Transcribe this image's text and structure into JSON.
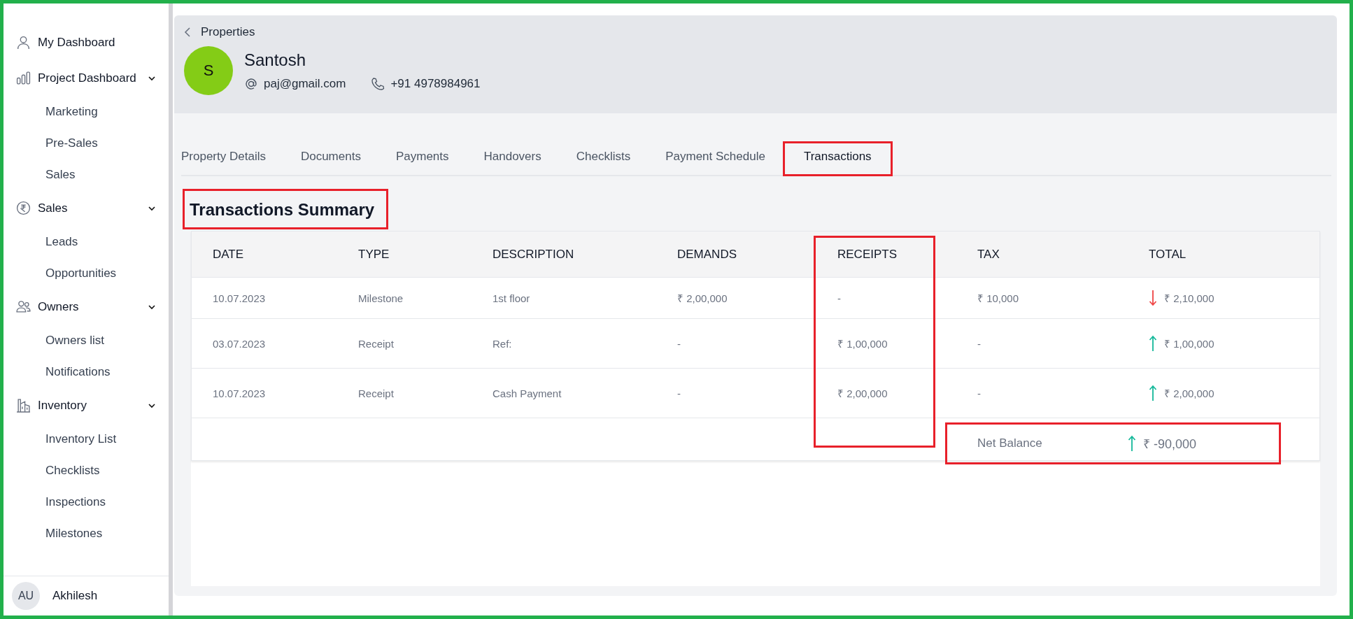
{
  "sidebar": {
    "items": [
      {
        "kind": "link",
        "label": "My Dashboard"
      },
      {
        "kind": "group",
        "label": "Project Dashboard",
        "expanded": true,
        "children": [
          {
            "label": "Marketing"
          },
          {
            "label": "Pre-Sales"
          },
          {
            "label": "Sales"
          }
        ]
      },
      {
        "kind": "group",
        "label": "Sales",
        "expanded": true,
        "children": [
          {
            "label": "Leads"
          },
          {
            "label": "Opportunities"
          }
        ]
      },
      {
        "kind": "group",
        "label": "Owners",
        "expanded": true,
        "children": [
          {
            "label": "Owners list"
          },
          {
            "label": "Notifications"
          }
        ]
      },
      {
        "kind": "group",
        "label": "Inventory",
        "expanded": true,
        "children": [
          {
            "label": "Inventory List"
          },
          {
            "label": "Checklists"
          },
          {
            "label": "Inspections"
          },
          {
            "label": "Milestones"
          }
        ]
      }
    ],
    "user": {
      "initials": "AU",
      "name": "Akhilesh"
    }
  },
  "header": {
    "back_label": "Properties",
    "avatar_letter": "S",
    "name": "Santosh",
    "email": "paj@gmail.com",
    "phone": "+91 4978984961"
  },
  "tabs": [
    {
      "label": "Property Details",
      "selected": false,
      "highlighted": false
    },
    {
      "label": "Documents",
      "selected": false,
      "highlighted": false
    },
    {
      "label": "Payments",
      "selected": false,
      "highlighted": false
    },
    {
      "label": "Handovers",
      "selected": false,
      "highlighted": false
    },
    {
      "label": "Checklists",
      "selected": false,
      "highlighted": false
    },
    {
      "label": "Payment Schedule",
      "selected": false,
      "highlighted": false
    },
    {
      "label": "Transactions",
      "selected": true,
      "highlighted": true
    }
  ],
  "summary": {
    "title": "Transactions Summary",
    "title_highlighted": true,
    "table": {
      "columns": [
        {
          "label": "DATE",
          "highlighted": false
        },
        {
          "label": "TYPE",
          "highlighted": false
        },
        {
          "label": "DESCRIPTION",
          "highlighted": false
        },
        {
          "label": "DEMANDS",
          "highlighted": false
        },
        {
          "label": "RECEIPTS",
          "highlighted": true
        },
        {
          "label": "TAX",
          "highlighted": false
        },
        {
          "label": "TOTAL",
          "highlighted": false
        }
      ],
      "rows": [
        {
          "cells": [
            "10.07.2023",
            "Milestone",
            "1st floor",
            "₹ 2,00,000",
            "-",
            "₹ 10,000"
          ],
          "total": "₹ 2,10,000",
          "rising": false
        },
        {
          "cells": [
            "03.07.2023",
            "Receipt",
            "Ref:",
            "-",
            "₹ 1,00,000",
            "-"
          ],
          "total": "₹ 1,00,000",
          "rising": true
        },
        {
          "cells": [
            "10.07.2023",
            "Receipt",
            "Cash Payment",
            "-",
            "₹ 2,00,000",
            "-"
          ],
          "total": "₹ 2,00,000",
          "rising": true
        }
      ],
      "net_balance": {
        "label": "Net Balance",
        "value": "₹ -90,000",
        "rising": true,
        "highlighted": true
      }
    }
  }
}
